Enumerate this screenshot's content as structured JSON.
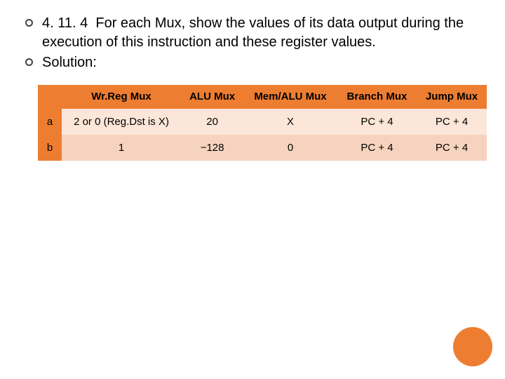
{
  "bullets": [
    {
      "number": "4. 11. 4",
      "text": "For each Mux, show the values of its data output during the execution of this instruction and these register values."
    },
    {
      "text": "Solution:"
    }
  ],
  "table": {
    "headers": [
      "Wr.Reg Mux",
      "ALU Mux",
      "Mem/ALU Mux",
      "Branch Mux",
      "Jump Mux"
    ],
    "rows": [
      {
        "label": "a",
        "cells": [
          "2 or 0 (Reg.Dst is X)",
          "20",
          "X",
          "PC + 4",
          "PC + 4"
        ]
      },
      {
        "label": "b",
        "cells": [
          "1",
          "−128",
          "0",
          "PC + 4",
          "PC + 4"
        ]
      }
    ]
  },
  "colors": {
    "accent": "#ed7d31"
  }
}
